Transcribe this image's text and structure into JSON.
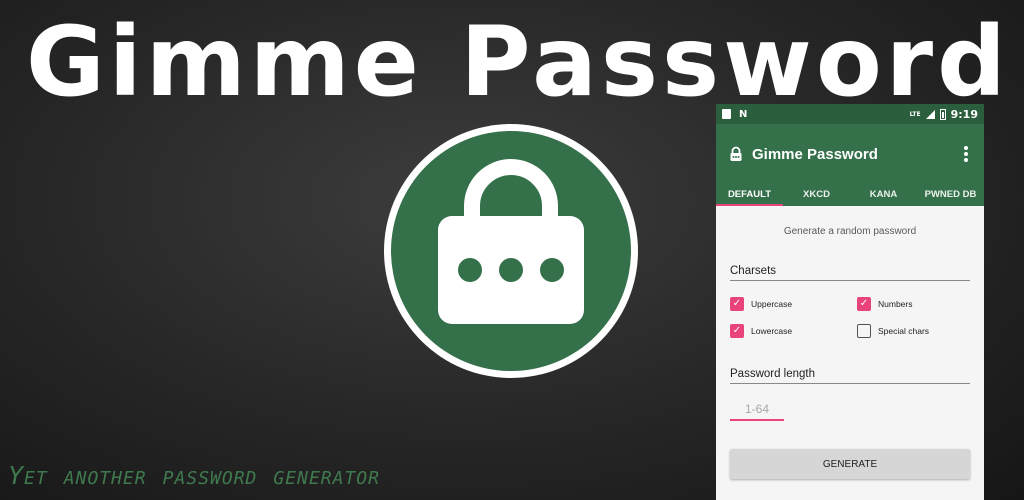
{
  "banner": {
    "title": "Gimme Password",
    "tagline": "Yet another password generator"
  },
  "logo": {
    "icon": "lock-icon",
    "color": "#34704a"
  },
  "status_bar": {
    "lte": "LTE",
    "time": "9:19"
  },
  "app_bar": {
    "title": "Gimme Password",
    "icon": "lock-icon"
  },
  "tabs": [
    {
      "label": "DEFAULT",
      "active": true
    },
    {
      "label": "XKCD",
      "active": false
    },
    {
      "label": "KANA",
      "active": false
    },
    {
      "label": "PWNED DB",
      "active": false
    }
  ],
  "main": {
    "subtitle": "Generate a random password",
    "charsets_label": "Charsets",
    "charsets": [
      {
        "label": "Uppercase",
        "checked": true
      },
      {
        "label": "Numbers",
        "checked": true
      },
      {
        "label": "Lowercase",
        "checked": true
      },
      {
        "label": "Special chars",
        "checked": false
      }
    ],
    "length_label": "Password length",
    "length_placeholder": "1-64",
    "generate_label": "GENERATE"
  },
  "colors": {
    "primary": "#34704a",
    "primary_dark": "#2b5e3d",
    "accent": "#e8437a"
  }
}
